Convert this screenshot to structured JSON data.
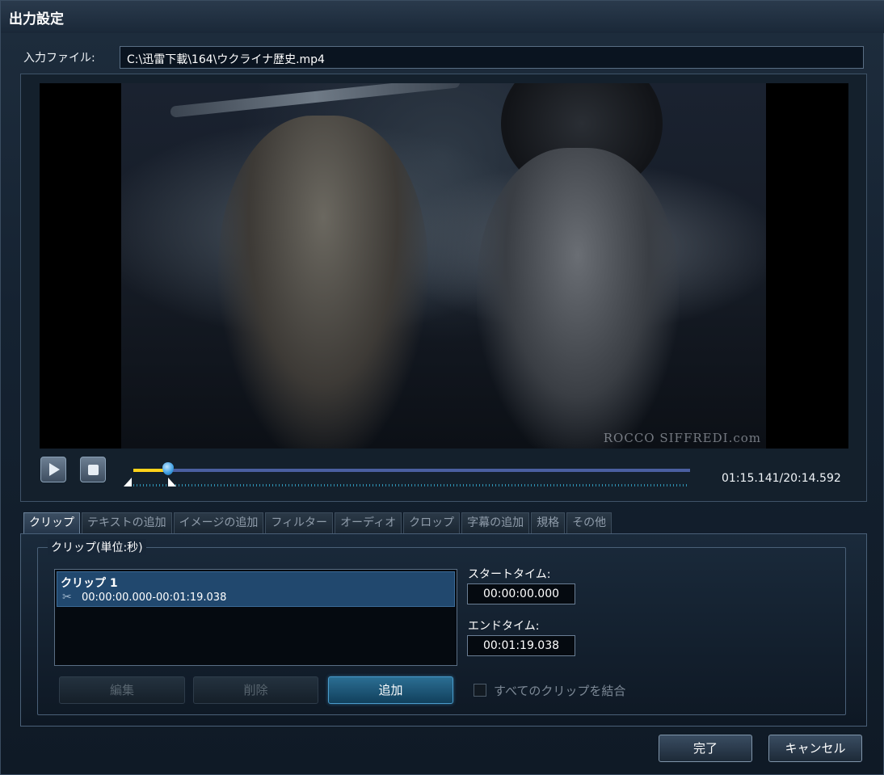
{
  "window": {
    "title": "出力設定"
  },
  "input_file": {
    "label": "入力ファイル:",
    "value": "C:\\迅雷下載\\164\\ウクライナ歴史.mp4"
  },
  "preview": {
    "watermark": "ROCCO SIFFREDI.com",
    "time_readout": "01:15.141/20:14.592",
    "progress_fraction": 0.062,
    "icons": [
      "play-icon",
      "stop-icon"
    ]
  },
  "tabs": [
    {
      "label": "クリップ",
      "active": true
    },
    {
      "label": "テキストの追加"
    },
    {
      "label": "イメージの追加"
    },
    {
      "label": "フィルター"
    },
    {
      "label": "オーディオ"
    },
    {
      "label": "クロップ"
    },
    {
      "label": "字幕の追加"
    },
    {
      "label": "規格"
    },
    {
      "label": "その他"
    }
  ],
  "clip_panel": {
    "group_label": "クリップ(単位:秒)",
    "clips": [
      {
        "name": "クリップ 1",
        "range": "00:00:00.000-00:01:19.038"
      }
    ],
    "start_label": "スタートタイム:",
    "start_value": "00:00:00.000",
    "end_label": "エンドタイム:",
    "end_value": "00:01:19.038",
    "edit_label": "編集",
    "delete_label": "削除",
    "add_label": "追加",
    "merge_label": "すべてのクリップを結合"
  },
  "footer": {
    "done_label": "完了",
    "cancel_label": "キャンセル"
  },
  "colors": {
    "accent": "#2b6e93",
    "progress": "#ffd21a",
    "selection": "#21486e"
  }
}
